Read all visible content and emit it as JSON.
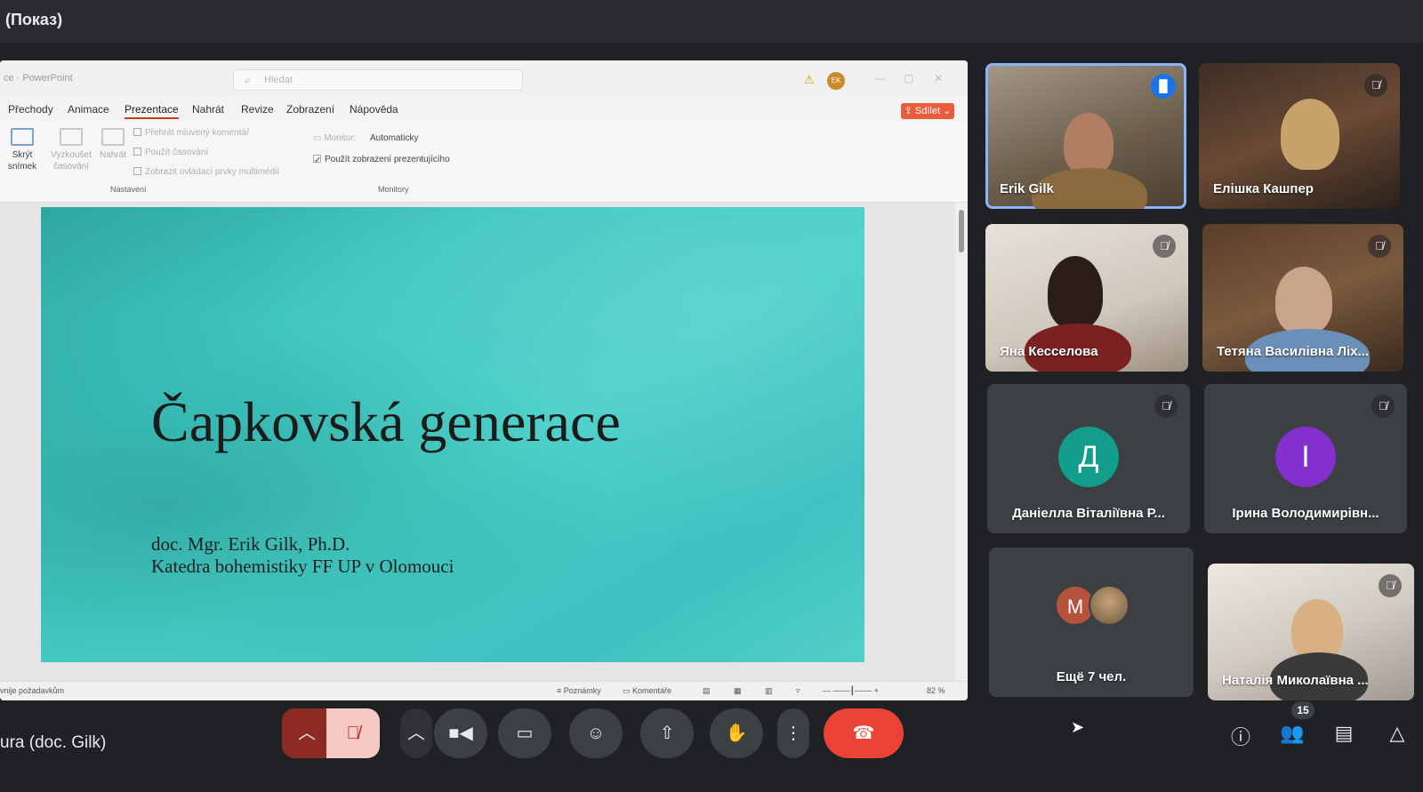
{
  "window": {
    "title": "(Показ)"
  },
  "presentation_app": {
    "app_name": "ce · PowerPoint",
    "search_placeholder": "Hledat",
    "user_initials": "EK",
    "menu_tabs": [
      "Přechody",
      "Animace",
      "Prezentace",
      "Nahrát",
      "Revize",
      "Zobrazení",
      "Nápověda"
    ],
    "active_tab": "Prezentace",
    "share_label": "Sdílet",
    "ribbon": {
      "hide_slide": "Skrýt snímek",
      "rehearse": "Vyzkoušet časování",
      "record": "Nahrát",
      "check_narration": "Přehrát mluvený komentář",
      "check_timings": "Použít časování",
      "check_media": "Zobrazit ovládací prvky multimédií",
      "group_setup": "Nastavení",
      "monitor_label": "Monitor:",
      "monitor_value": "Automaticky",
      "check_presenter": "Použít zobrazení prezentujícího",
      "group_monitors": "Monitory"
    },
    "slide": {
      "title": "Čapkovská generace",
      "author": "doc. Mgr. Erik Gilk, Ph.D.",
      "department": "Katedra bohemistiky FF UP v Olomouci"
    },
    "status": {
      "left_text": "vnije požadavkům",
      "notes": "Poznámky",
      "comments": "Komentáře",
      "zoom": "82 %"
    }
  },
  "participants": [
    {
      "name": "Erik Gilk",
      "speaking": true
    },
    {
      "name": "Елішка Кашпер",
      "muted": true
    },
    {
      "name": "Яна Кесселова",
      "muted": true
    },
    {
      "name": "Тетяна Василівна Ліх...",
      "muted": true
    },
    {
      "name": "Даніелла Віталіївна Р...",
      "muted": true,
      "avatar_letter": "Д",
      "avatar_color": "#129e8a"
    },
    {
      "name": "Ірина Володимирівн...",
      "muted": true,
      "avatar_letter": "І",
      "avatar_color": "#8430ce"
    },
    {
      "name": "Ещё 7 чел.",
      "avatar_letter": "M"
    },
    {
      "name": "Наталія Миколаївна ...",
      "muted": true
    }
  ],
  "bottom_bar": {
    "meeting_label": "ura (doc. Gilk)",
    "participant_count": "15"
  }
}
